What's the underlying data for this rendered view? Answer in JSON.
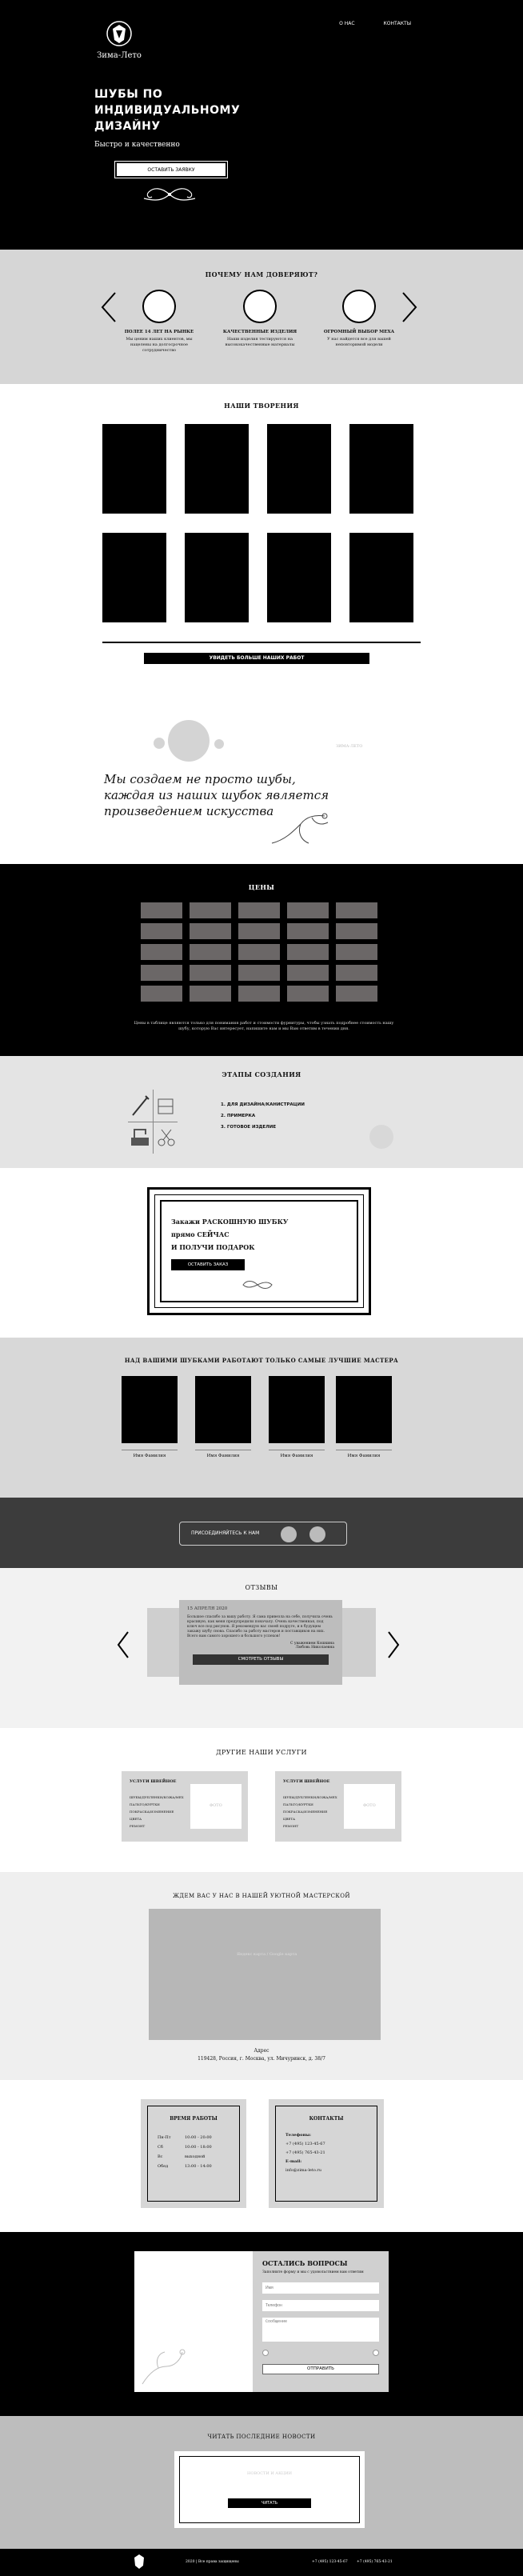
{
  "header": {
    "logo_text": "Зима-Лето",
    "nav": [
      "О НАС",
      "КОНТАКТЫ"
    ],
    "headline": "ШУБЫ ПО ИНДИВИДУАЛЬНОМУ ДИЗАЙНУ",
    "subhead": "Быстро и качественно",
    "cta": "ОСТАВИТЬ ЗАЯВКУ"
  },
  "why": {
    "title": "ПОЧЕМУ НАМ ДОВЕРЯЮТ?",
    "items": [
      {
        "title": "ПОЛЕЕ 14 ЛЕТ НА РЫНКЕ",
        "text": "Мы ценим наших клиентов, мы нацелены на долгосрочное сотрудничество"
      },
      {
        "title": "КАЧЕСТВЕННЫЕ ИЗДЕЛИЯ",
        "text": "Наши изделия тестируются на высококачественные материалы"
      },
      {
        "title": "ОГРОМНЫЙ ВЫБОР МЕХА",
        "text": "У нас найдется все для вашей неповторимой модели"
      }
    ]
  },
  "works": {
    "title": "НАШИ ТВОРЕНИЯ",
    "button": "УВИДЕТЬ БОЛЬШЕ НАШИХ РАБОТ"
  },
  "quote": {
    "text": "Мы создаем не просто шубы, каждая из наших шубок является произведением искусства",
    "faint": "ЗИМА-ЛЕТО"
  },
  "prices": {
    "title": "ЦЕНЫ",
    "note": "Цены в таблице являются только для понимания работ и стоимости фурнитуры, чтобы узнать подробнее стоимость нашу шубу, которую Вас интересует, напишите нам и мы Вам ответим в течении дня."
  },
  "stages": {
    "title": "ЭТАПЫ СОЗДАНИЯ",
    "steps": [
      "1. ДЛЯ ДИЗАЙНА/КАНИСТРАЦИИ",
      "2. ПРИМЕРКА",
      "3. ГОТОВОЕ ИЗДЕЛИЕ"
    ]
  },
  "offer": {
    "line1": "Закажи РАСКОШНУЮ ШУБКУ",
    "line2": "прямо СЕЙЧАС",
    "line3": "И ПОЛУЧИ ПОДАРОК",
    "button": "ОСТАВИТЬ ЗАКАЗ"
  },
  "masters": {
    "title": "НАД ВАШИМИ ШУБКАМИ РАБОТАЮТ ТОЛЬКО САМЫЕ ЛУЧШИЕ МАСТЕРА",
    "names": [
      "Имя Фамилия",
      "Имя Фамилия",
      "Имя Фамилия",
      "Имя Фамилия"
    ]
  },
  "join": {
    "label": "ПРИСОЕДИНЯЙТЕСЬ К НАМ"
  },
  "reviews": {
    "title": "ОТЗЫВЫ",
    "date": "15 АПРЕЛЯ 2020",
    "text": "Большое спасибо за вашу работу. Я сама привезла на себе, получила очень красивую, как меня предупредили поначалу. Очень качественная, под ключ все под рисунок. Я рекомендую вас своей подруге, и в будущем закажу шубу снова. Спасибо за работу мастеров и поставщиков на них. Всего вам самого хорошего и большого успехов!",
    "sign1": "С уважением Кошкина",
    "sign2": "Любовь Николаевна",
    "button": "СМОТРЕТЬ ОТЗЫВЫ"
  },
  "services": {
    "title": "ДРУГИЕ НАШИ УСЛУГИ",
    "cards": [
      {
        "title": "УСЛУГИ ШВЕЙНОЕ",
        "items": [
          "ШУБЫ/ДУБЛЕНКИ/КОЖА/МЕХ",
          "ПАЛЬТО/КУРТКИ",
          "ПОКРАСКА/ИЗМЕНЕНИЕ ЦВЕТА",
          "РЕМОНТ"
        ],
        "img": "ФОТО"
      },
      {
        "title": "УСЛУГИ ШВЕЙНОЕ",
        "items": [
          "ШУБЫ/ДУБЛЕНКИ/КОЖА/МЕХ",
          "ПАЛЬТО/КУРТКИ",
          "ПОКРАСКА/ИЗМЕНЕНИЕ ЦВЕТА",
          "РЕМОНТ"
        ],
        "img": "ФОТО"
      }
    ]
  },
  "map": {
    "title": "ЖДЕМ ВАС У НАС В НАШЕЙ УЮТНОЙ МАСТЕРСКОЙ",
    "map_label": "Яндекс карта / Google карта",
    "addr_label": "Адрес",
    "address": "119428, Россия, г. Москва, ул. Мичуринск, д. 38/7"
  },
  "hours": {
    "title": "ВРЕМЯ РАБОТЫ",
    "rows": [
      [
        "Пн-Пт",
        "10:00 - 20:00"
      ],
      [
        "Сб",
        "10:00 - 18:00"
      ],
      [
        "Вс",
        "выходной"
      ],
      [
        "Обед",
        "13:00 - 14:00"
      ]
    ]
  },
  "contacts": {
    "title": "КОНТАКТЫ",
    "lines": [
      "Телефоны:",
      "+7 (495) 123-45-67",
      "+7 (495) 765-43-21",
      "E-mail:",
      "info@zima-leto.ru"
    ]
  },
  "question": {
    "title": "ОСТАЛИСЬ ВОПРОСЫ",
    "sub": "Заполните форму и мы с удовольствием вам ответим",
    "placeholders": [
      "Имя",
      "Телефон",
      "Сообщение"
    ],
    "check1": "",
    "check2": "",
    "button": "ОТПРАВИТЬ"
  },
  "news": {
    "title": "ЧИТАТЬ ПОСЛЕДНИЕ НОВОСТИ",
    "inner": "НОВОСТИ И АКЦИИ",
    "button": "ЧИТАТЬ"
  },
  "footer": {
    "copy": "2020 | Все права защищены",
    "phone1": "+7 (495) 123-45-67",
    "phone2": "+7 (495) 765-43-21"
  }
}
